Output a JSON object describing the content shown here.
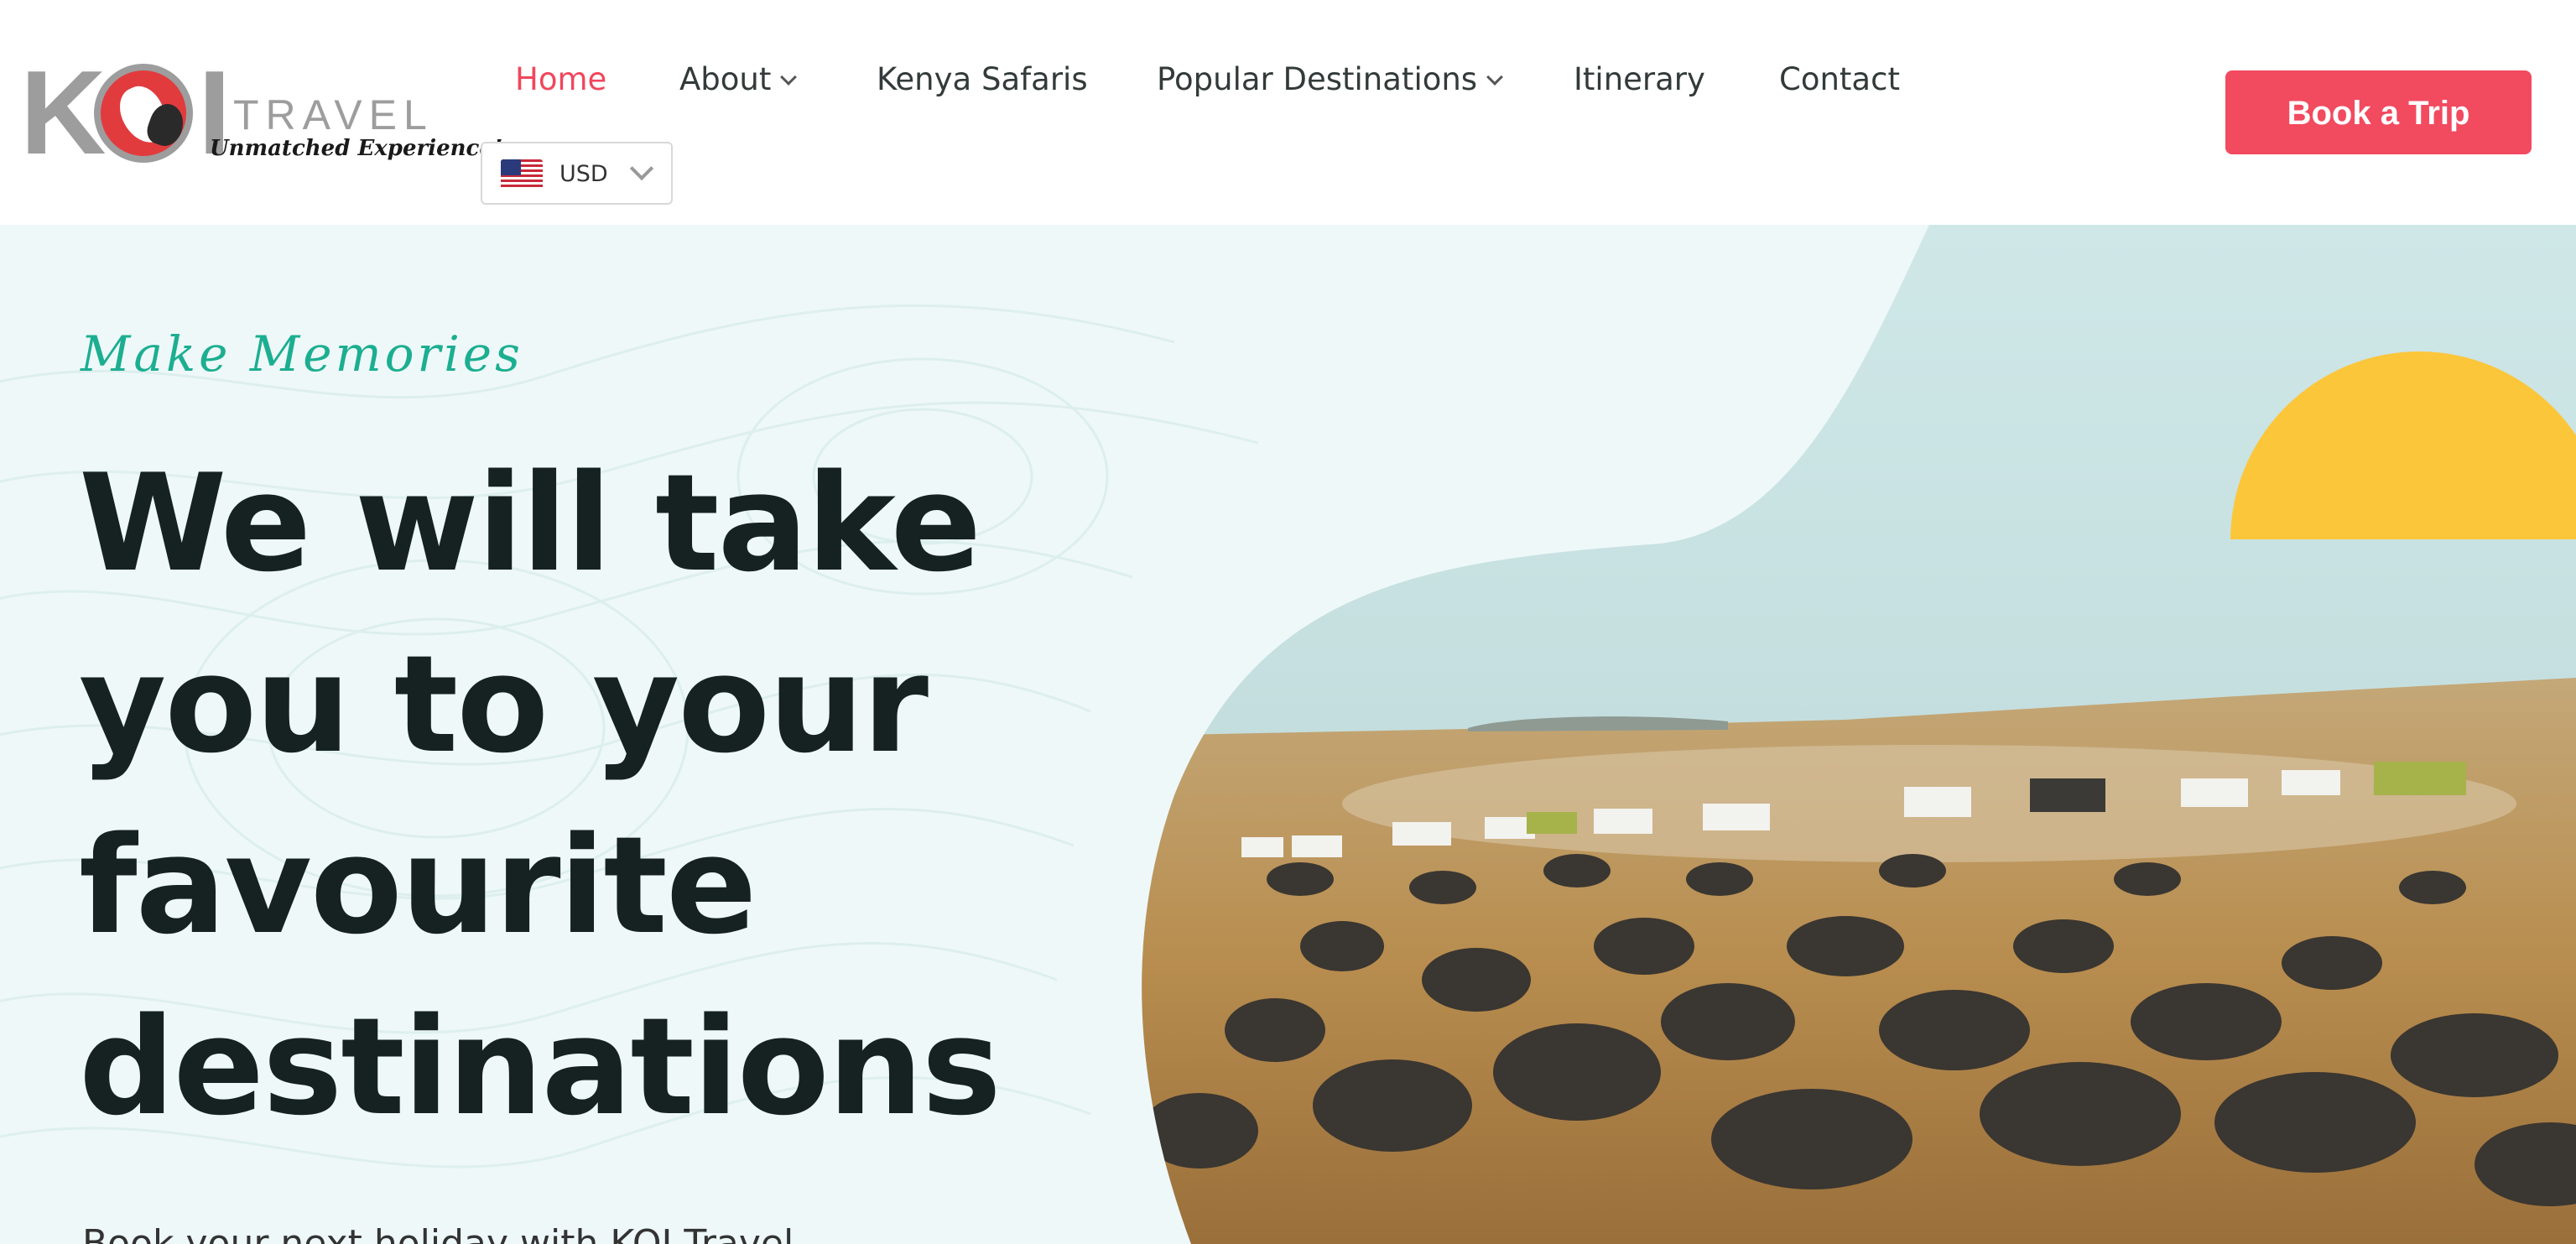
{
  "logo": {
    "letters": "KOI",
    "wordmark": "TRAVEL",
    "tagline": "Unmatched Experience!"
  },
  "nav": {
    "items": [
      {
        "label": "Home",
        "active": true,
        "dropdown": false
      },
      {
        "label": "About",
        "active": false,
        "dropdown": true
      },
      {
        "label": "Kenya Safaris",
        "active": false,
        "dropdown": false
      },
      {
        "label": "Popular Destinations",
        "active": false,
        "dropdown": true
      },
      {
        "label": "Itinerary",
        "active": false,
        "dropdown": false
      },
      {
        "label": "Contact",
        "active": false,
        "dropdown": false
      }
    ]
  },
  "currency": {
    "selected": "USD",
    "flag_icon": "us-flag-icon"
  },
  "cta": {
    "book_label": "Book a Trip"
  },
  "hero": {
    "tagline": "Make Memories",
    "headline": "We will take you to your favourite destinations",
    "subtext": "Book your next holiday with KOI Travel"
  },
  "colors": {
    "accent": "#f24a5f",
    "active_nav": "#f0475c",
    "tagline": "#1cae91",
    "sun": "#fcc63b",
    "headline": "#162222",
    "hero_bg": "#eef8f8"
  }
}
